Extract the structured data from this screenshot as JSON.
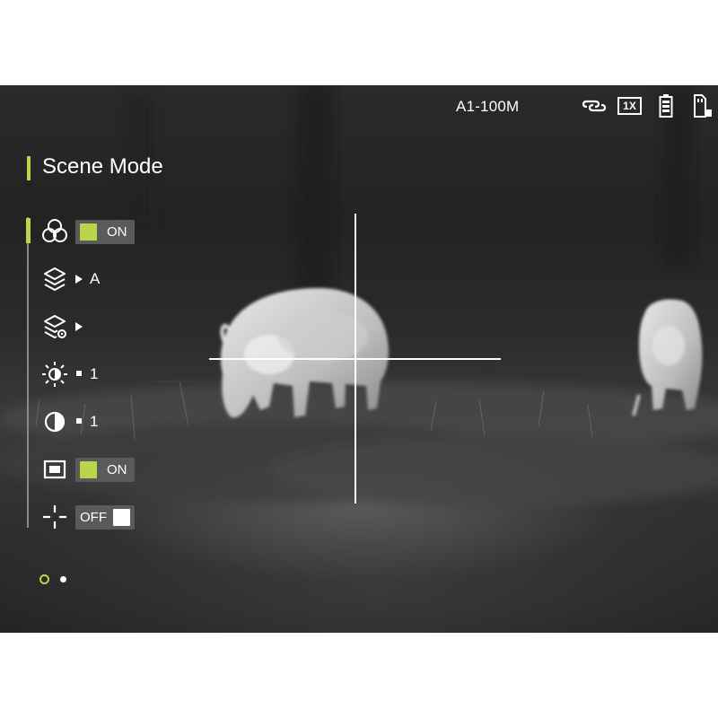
{
  "status_bar": {
    "range_text": "A1-100M",
    "icons": [
      "link-icon",
      "zoom-1x-icon",
      "battery-icon",
      "storage-card-icon"
    ],
    "zoom_label": "1X"
  },
  "menu": {
    "title": "Scene Mode",
    "items": [
      {
        "name": "color-palette",
        "icon": "palette-circles-icon",
        "control": "toggle",
        "state": "ON",
        "active": true
      },
      {
        "name": "scene-layer",
        "icon": "layers-icon",
        "control": "arrow",
        "value": "A"
      },
      {
        "name": "layer-settings",
        "icon": "layers-settings-icon",
        "control": "arrow",
        "value": ""
      },
      {
        "name": "brightness",
        "icon": "brightness-sun-icon",
        "control": "square",
        "value": "1"
      },
      {
        "name": "contrast",
        "icon": "contrast-icon",
        "control": "square",
        "value": "1"
      },
      {
        "name": "picture-in-picture",
        "icon": "pip-frame-icon",
        "control": "toggle",
        "state": "ON"
      },
      {
        "name": "reticle",
        "icon": "crosshair-icon",
        "control": "toggle",
        "state": "OFF"
      }
    ]
  },
  "pagination": {
    "pages": 2,
    "current": 1
  },
  "colors": {
    "accent": "#b9d64a",
    "toggle_bg": "#5a5a5a",
    "text": "#ffffff"
  }
}
